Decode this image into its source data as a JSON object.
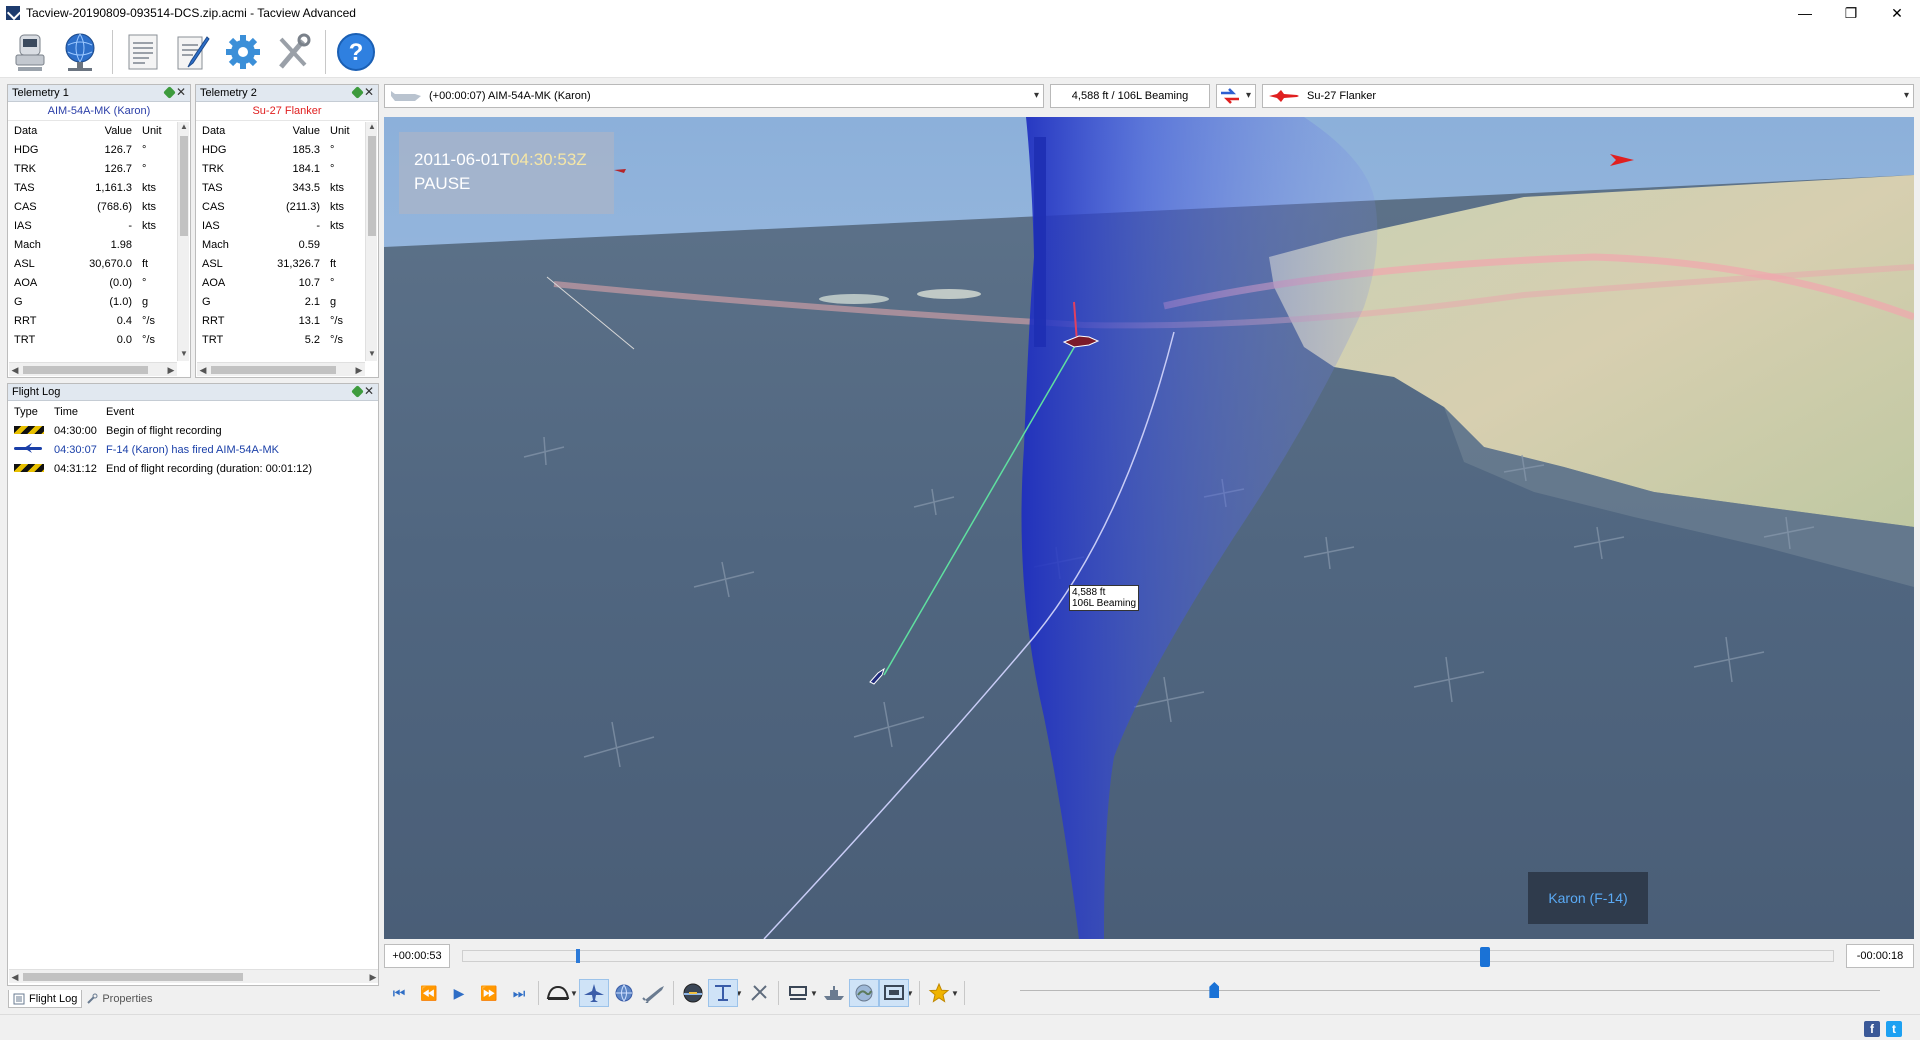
{
  "window": {
    "title": "Tacview-20190809-093514-DCS.zip.acmi - Tacview Advanced",
    "minimize_glyph": "—",
    "restore_glyph": "❐",
    "close_glyph": "✕"
  },
  "toolbar": {
    "icons": [
      "recorder-icon",
      "globe-network-icon",
      "document-icon",
      "edit-pen-icon",
      "settings-gear-icon",
      "tools-icon",
      "help-icon"
    ],
    "help_glyph": "?"
  },
  "telemetry1": {
    "title": "Telemetry 1",
    "object": "AIM-54A-MK (Karon)",
    "object_color": "#2a3ea8",
    "headers": {
      "data": "Data",
      "value": "Value",
      "unit": "Unit"
    },
    "rows": [
      {
        "data": "HDG",
        "value": "126.7",
        "unit": "°"
      },
      {
        "data": "TRK",
        "value": "126.7",
        "unit": "°"
      },
      {
        "data": "TAS",
        "value": "1,161.3",
        "unit": "kts"
      },
      {
        "data": "CAS",
        "value": "(768.6)",
        "unit": "kts"
      },
      {
        "data": "IAS",
        "value": "-",
        "unit": "kts"
      },
      {
        "data": "Mach",
        "value": "1.98",
        "unit": ""
      },
      {
        "data": "ASL",
        "value": "30,670.0",
        "unit": "ft"
      },
      {
        "data": "AOA",
        "value": "(0.0)",
        "unit": "°"
      },
      {
        "data": "G",
        "value": "(1.0)",
        "unit": "g"
      },
      {
        "data": "RRT",
        "value": "0.4",
        "unit": "°/s"
      },
      {
        "data": "TRT",
        "value": "0.0",
        "unit": "°/s"
      }
    ]
  },
  "telemetry2": {
    "title": "Telemetry 2",
    "object": "Su-27 Flanker",
    "object_color": "#e02020",
    "headers": {
      "data": "Data",
      "value": "Value",
      "unit": "Unit"
    },
    "rows": [
      {
        "data": "HDG",
        "value": "185.3",
        "unit": "°"
      },
      {
        "data": "TRK",
        "value": "184.1",
        "unit": "°"
      },
      {
        "data": "TAS",
        "value": "343.5",
        "unit": "kts"
      },
      {
        "data": "CAS",
        "value": "(211.3)",
        "unit": "kts"
      },
      {
        "data": "IAS",
        "value": "-",
        "unit": "kts"
      },
      {
        "data": "Mach",
        "value": "0.59",
        "unit": ""
      },
      {
        "data": "ASL",
        "value": "31,326.7",
        "unit": "ft"
      },
      {
        "data": "AOA",
        "value": "10.7",
        "unit": "°"
      },
      {
        "data": "G",
        "value": "2.1",
        "unit": "g"
      },
      {
        "data": "RRT",
        "value": "13.1",
        "unit": "°/s"
      },
      {
        "data": "TRT",
        "value": "5.2",
        "unit": "°/s"
      }
    ]
  },
  "flight_log": {
    "title": "Flight Log",
    "headers": {
      "type": "Type",
      "time": "Time",
      "event": "Event"
    },
    "rows": [
      {
        "type": "marker",
        "time": "04:30:00",
        "event": "Begin of flight recording",
        "color": "#000000"
      },
      {
        "type": "fired",
        "time": "04:30:07",
        "event": "F-14 (Karon) has fired AIM-54A-MK",
        "color": "#1a3fa8"
      },
      {
        "type": "marker",
        "time": "04:31:12",
        "event": "End of flight recording (duration: 00:01:12)",
        "color": "#000000"
      }
    ]
  },
  "bottom_tabs": [
    {
      "label": "Flight Log",
      "active": true
    },
    {
      "label": "Properties",
      "active": false
    }
  ],
  "view_bar": {
    "primary_object": "(+00:00:07) AIM-54A-MK (Karon)",
    "range_label": "4,588 ft / 106L Beaming",
    "secondary_object": "Su-27 Flanker"
  },
  "viewport": {
    "datetime_prefix": "2011-06-01T",
    "datetime_time": "04:30:53Z",
    "status": "PAUSE",
    "hud_tag_line1": "4,588 ft",
    "hud_tag_line2": "106L Beaming",
    "camera_label": "Karon (F-14)"
  },
  "timeline": {
    "elapsed": "+00:00:53",
    "remaining": "-00:00:18",
    "progress": 0.745,
    "start_marker": 0.082
  },
  "playback": {
    "speed_level": 0.226
  },
  "colors": {
    "accent": "#1a72d6",
    "sea": "#4f657e",
    "sky": "#8fb3dc"
  }
}
